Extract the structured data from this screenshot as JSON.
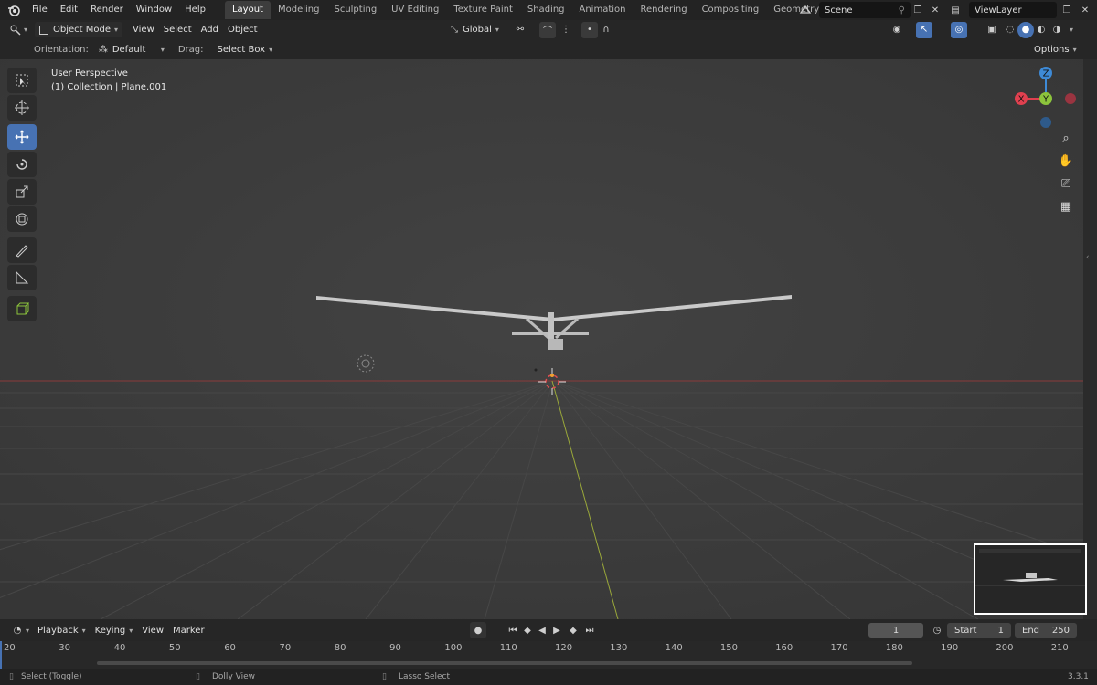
{
  "menu": [
    "File",
    "Edit",
    "Render",
    "Window",
    "Help"
  ],
  "workspaces": [
    "Layout",
    "Modeling",
    "Sculpting",
    "UV Editing",
    "Texture Paint",
    "Shading",
    "Animation",
    "Rendering",
    "Compositing",
    "Geometry Nodes"
  ],
  "scene": "Scene",
  "view_layer": "ViewLayer",
  "header": {
    "mode": "Object Mode",
    "view": "View",
    "select": "Select",
    "add": "Add",
    "object": "Object",
    "transform": "Global",
    "options": "Options"
  },
  "subheader": {
    "orientation_label": "Orientation:",
    "orientation_value": "Default",
    "drag_label": "Drag:",
    "drag_value": "Select Box"
  },
  "viewport": {
    "perspective": "User Perspective",
    "collection": "(1) Collection | Plane.001"
  },
  "gizmo": {
    "x": "X",
    "y": "Y",
    "z": "Z"
  },
  "timeline": {
    "playback": "Playback",
    "keying": "Keying",
    "view": "View",
    "marker": "Marker",
    "current_frame": "1",
    "start_label": "Start",
    "start": "1",
    "end_label": "End",
    "end": "250",
    "ticks": [
      "20",
      "30",
      "40",
      "50",
      "60",
      "70",
      "80",
      "90",
      "100",
      "110",
      "120",
      "130",
      "140",
      "150",
      "160",
      "170",
      "180",
      "190",
      "200",
      "210"
    ]
  },
  "status": {
    "select": "Select (Toggle)",
    "dolly": "Dolly View",
    "lasso": "Lasso Select",
    "version": "3.3.1"
  },
  "colors": {
    "accent": "#4772b3",
    "axis_x": "#e0404f",
    "axis_y": "#8cc43c",
    "axis_z": "#3e8ad6"
  }
}
